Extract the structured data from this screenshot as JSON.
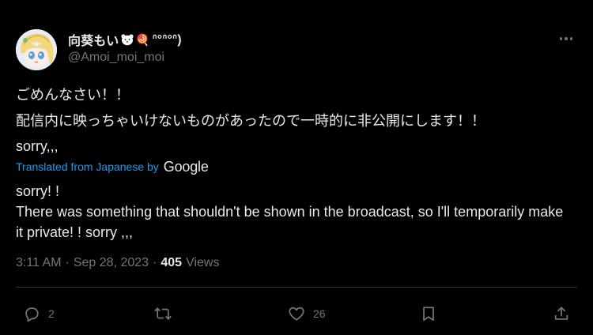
{
  "author": {
    "display_name": "向葵もい",
    "name_suffix": "ᐢ°ᐢ°ᐢ)",
    "handle": "@Amoi_moi_moi",
    "avatar_icon": "anime-avatar",
    "emojis": [
      "polar-bear-emoji",
      "lollipop-emoji"
    ]
  },
  "post": {
    "lines_original": [
      "ごめんなさい！！",
      "配信内に映っちゃいけないものがあったので一時的に非公開にします！！",
      "sorry,,,"
    ],
    "translation_label": "Translated from Japanese by",
    "translation_provider": "Google",
    "lines_translated": [
      "sorry! !",
      "There was something that shouldn't be shown in the broadcast, so I'll temporarily make it private! ! sorry ,,,"
    ]
  },
  "meta": {
    "time": "3:11 AM",
    "separator": "·",
    "date": "Sep 28, 2023",
    "views_count": "405",
    "views_label": "Views"
  },
  "actions": {
    "reply_count": "2",
    "retweet_count": "",
    "like_count": "26",
    "icon_color": "#71767b"
  },
  "colors": {
    "background": "#000000",
    "text_primary": "#e7e9ea",
    "text_secondary": "#71767b",
    "link": "#1d9bf0",
    "divider": "#2f3336"
  }
}
